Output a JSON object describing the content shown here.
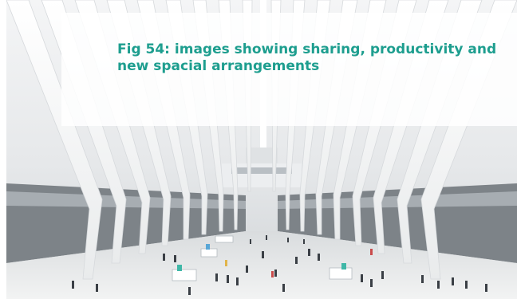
{
  "figure": {
    "caption": "Fig 54: images showing sharing, productivity and new spacial arrangements",
    "accent_color": "#1e9e8f",
    "photo_subject": "white ribbed vaulted atrium hall with people walking on the floor"
  }
}
